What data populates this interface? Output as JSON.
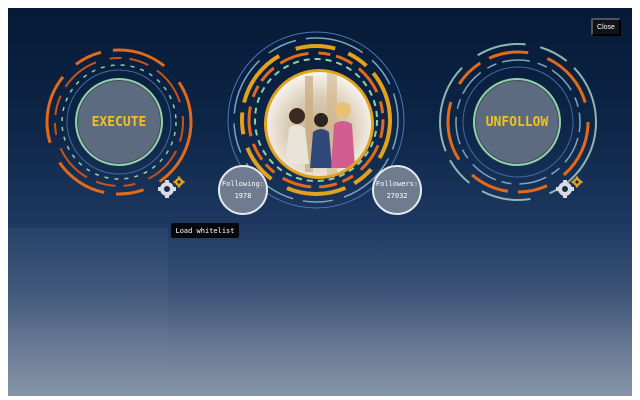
{
  "buttons": {
    "execute": "EXECUTE",
    "unfollow": "UNFOLLOW",
    "close": "Close"
  },
  "stats": {
    "following": {
      "label": "Following:",
      "value": "1978"
    },
    "followers": {
      "label": "Followers:",
      "value": "27032"
    }
  },
  "tooltip": {
    "text": "Load whitelist"
  },
  "icons": {
    "settings_left": "gear-cluster-icon",
    "settings_right": "gear-cluster-icon",
    "profile": "profile-photo"
  },
  "colors": {
    "accent_text": "#f2c21a",
    "ring_orange": "#e36a18",
    "ring_teal": "#8fd3a6",
    "ring_blue": "#4a76b8",
    "avatar_border": "#e2a21e"
  }
}
